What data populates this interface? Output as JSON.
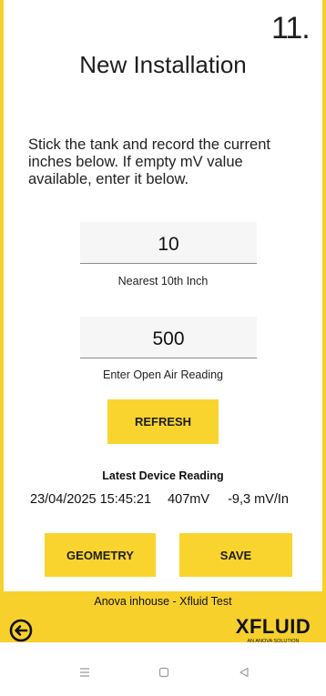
{
  "header": {
    "step": "11.",
    "title": "New Installation"
  },
  "instructions": "Stick the tank and record the current inches below. If empty mV value available, enter it below.",
  "inches_field": {
    "value": "10",
    "caption": "Nearest 10th Inch"
  },
  "open_air_field": {
    "value": "500",
    "caption": "Enter Open Air Reading"
  },
  "buttons": {
    "refresh": "REFRESH",
    "geometry": "GEOMETRY",
    "save": "SAVE"
  },
  "reading": {
    "label": "Latest Device Reading",
    "timestamp": "23/04/2025 15:45:21",
    "millivolts": "407mV",
    "rate": "-9,3 mV/In"
  },
  "footer": {
    "site": "Anova inhouse - Xfluid Test",
    "logo_text": "XFLUID",
    "logo_tagline": "AN ANOVA SOLUTION",
    "back_icon": "back-arrow-circle-icon"
  },
  "colors": {
    "accent": "#f7d02c",
    "button": "#f9d42e"
  },
  "system_nav": {
    "icons": [
      "recent-apps-icon",
      "home-icon",
      "back-icon"
    ]
  }
}
